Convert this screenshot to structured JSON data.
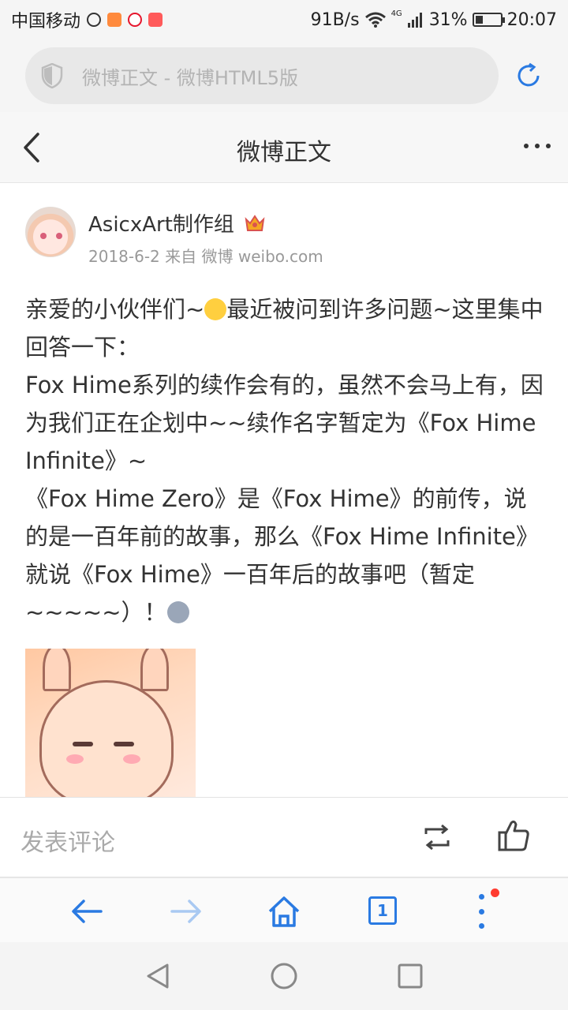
{
  "status_bar": {
    "carrier": "中国移动",
    "net_speed": "91B/s",
    "network_type": "4G",
    "battery": "31%",
    "battery_level": 0.31,
    "time": "20:07"
  },
  "browser": {
    "url_text": "微博正文 - 微博HTML5版",
    "tab_count": "1"
  },
  "page": {
    "title": "微博正文"
  },
  "post": {
    "author": "AsicxArt制作组",
    "meta": "2018-6-2 来自 微博 weibo.com",
    "lines": [
      "亲爱的小伙伴们~",
      "最近被问到许多问题~这里集中回答一下：",
      "Fox Hime系列的续作会有的，虽然不会马上有，因为我们正在企划中~~续作名字暂定为《Fox Hime Infinite》~",
      "《Fox Hime Zero》是《Fox Hime》的前传，说的是一百年前的故事，那么《Fox Hime Infinite》就说《Fox Hime》一百年后的故事吧（暂定~~~~~）！"
    ]
  },
  "comment_bar": {
    "placeholder": "发表评论"
  },
  "colors": {
    "accent": "#2a7ae2",
    "accent_light": "#a9c9f2",
    "notification_dot": "#ff3b30"
  }
}
